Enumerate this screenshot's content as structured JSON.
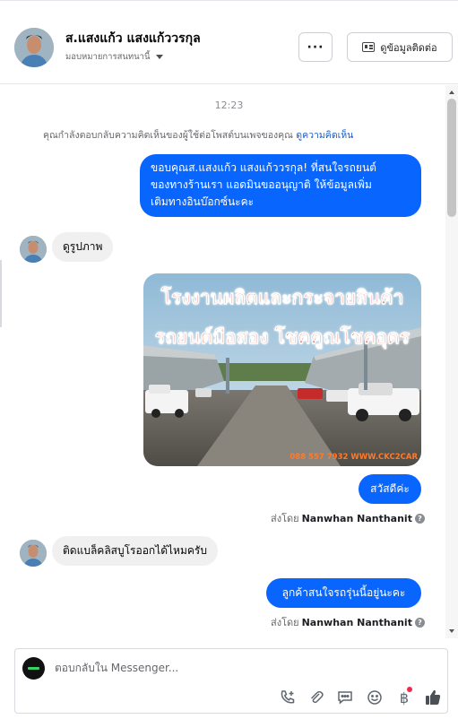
{
  "header": {
    "title": "ส.แสงแก้ว แสงแก้ววรกุล",
    "assign_label": "มอบหมายการสนทนานี้",
    "more_label": "···",
    "contact_label": "ดูข้อมูลติดต่อ"
  },
  "chat": {
    "timestamp": "12:23",
    "notice_text": "คุณกำลังตอบกลับความคิดเห็นของผู้ใช้ต่อโพสต์บนเพจของคุณ",
    "notice_link": "ดูความคิดเห็น",
    "messages": {
      "greeting_line1": "ขอบคุณส.แสงแก้ว แสงแก้ววรกุล! ที่สนใจรถยนต์",
      "greeting_line2": "ของทางร้านเรา แอดมินขออนุญาติ ให้ข้อมูลเพิ่ม",
      "greeting_line3": "เติมทางอินบ๊อกซ์นะคะ",
      "customer_1": "ดูรูปภาพ",
      "image_text_1": "โรงงานผลิตและกระจายสินค้า",
      "image_text_2": "รถยนต์มือสอง โชคคูณโชคอุดร",
      "image_caption": "088 557 7932 WWW.CKC2CAR",
      "reply_1": "สวัสดีค่ะ",
      "sent_by_label_1": "ส่งโดย",
      "sent_by_name_1": "Nanwhan Nanthanit",
      "customer_2": "ติดแบล็คลิสบูโรออกได้ไหมครับ",
      "reply_2": "ลูกค้าสนใจรถรุ่นนี้อยู่นะคะ",
      "sent_by_label_2": "ส่งโดย",
      "sent_by_name_2": "Nanwhan Nanthanit"
    }
  },
  "composer": {
    "placeholder": "ตอบกลับใน Messenger...",
    "tools": [
      "phone-plus-icon",
      "paperclip-icon",
      "quick-reply-icon",
      "emoji-icon",
      "baht-icon",
      "thumbs-up-icon"
    ],
    "baht_symbol": "฿"
  },
  "colors": {
    "accent": "#0866ff",
    "bubble_in": "#f0f0f0",
    "link": "#1d5ec7",
    "notification_dot": "#f02849"
  }
}
